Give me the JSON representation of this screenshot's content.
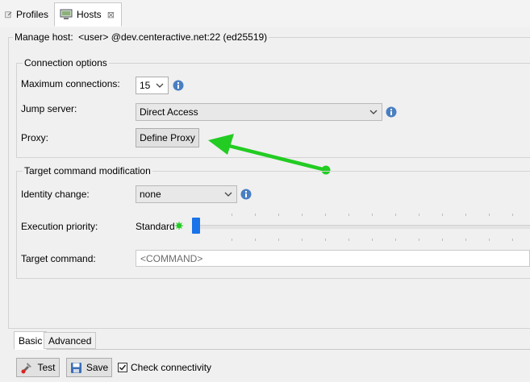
{
  "tabs": {
    "profiles_label": "Profiles",
    "hosts_label": "Hosts"
  },
  "manage_host": {
    "label": "Manage host:",
    "value": "<user> @dev.centeractive.net:22 (ed25519)"
  },
  "connection": {
    "title": "Connection options",
    "max_label": "Maximum connections:",
    "max_value": "15",
    "jump_label": "Jump server:",
    "jump_value": "Direct Access",
    "proxy_label": "Proxy:",
    "define_proxy": "Define Proxy"
  },
  "target": {
    "title": "Target command modification",
    "identity_label": "Identity change:",
    "identity_value": "none",
    "priority_label": "Execution priority:",
    "priority_value": "Standard",
    "priority_level": 0,
    "command_label": "Target command:",
    "command_placeholder": "<COMMAND>"
  },
  "bottom_tabs": {
    "basic": "Basic",
    "advanced": "Advanced"
  },
  "actions": {
    "test": "Test",
    "save": "Save",
    "check_label": "Check connectivity",
    "check_checked": true
  },
  "colors": {
    "annotation_arrow": "#22cc22",
    "slider_thumb": "#1a73e8",
    "info_icon": "#4a7fc1"
  }
}
